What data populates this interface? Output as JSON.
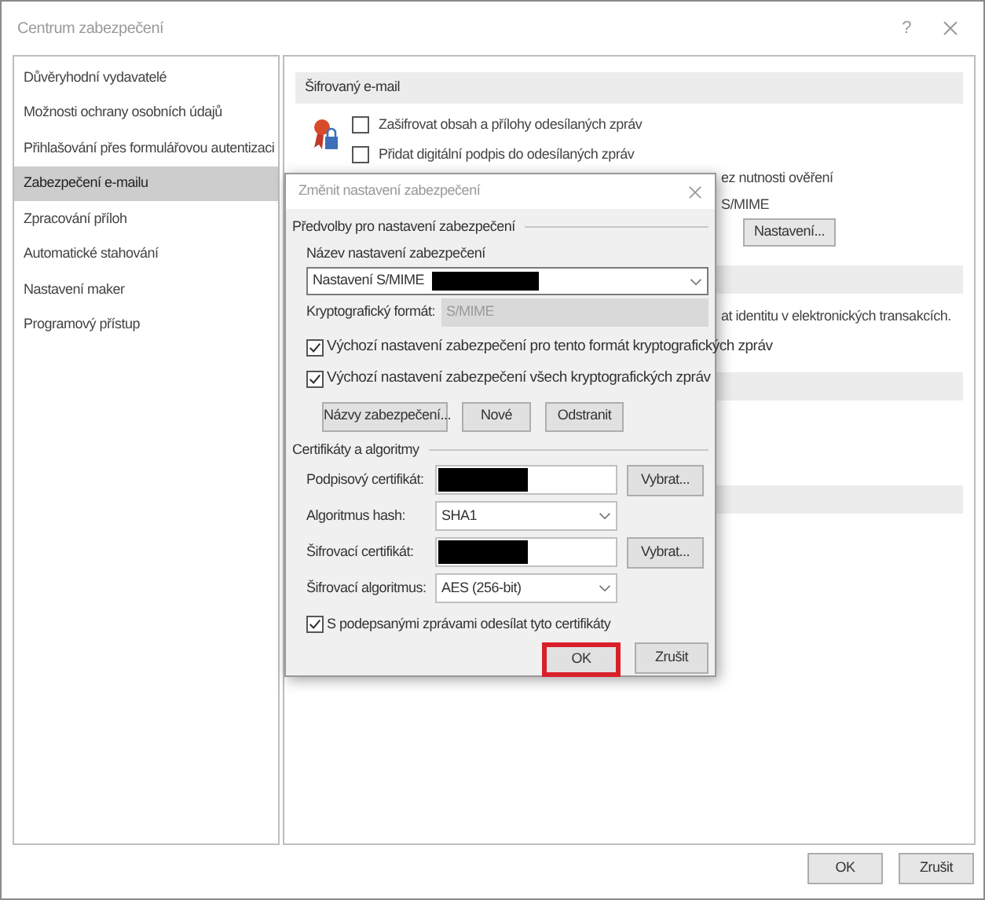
{
  "window": {
    "title": "Centrum zabezpečení",
    "help": "?"
  },
  "sidebar": {
    "items": [
      {
        "label": "Důvěryhodní vydavatelé",
        "selected": false
      },
      {
        "label": "Možnosti ochrany osobních údajů",
        "selected": false
      },
      {
        "label": "Přihlašování přes formulářovou autentizaci",
        "selected": false
      },
      {
        "label": "Zabezpečení e-mailu",
        "selected": true
      },
      {
        "label": "Zpracování příloh",
        "selected": false
      },
      {
        "label": "Automatické stahování",
        "selected": false
      },
      {
        "label": "Nastavení maker",
        "selected": false
      },
      {
        "label": "Programový přístup",
        "selected": false
      }
    ]
  },
  "content": {
    "section_title": "Šifrovaný e-mail",
    "options": [
      {
        "label": "Zašifrovat obsah a přílohy odesílaných zpráv",
        "checked": false
      },
      {
        "label": "Přidat digitální podpis do odesílaných zpráv",
        "checked": false
      }
    ],
    "partial_line_1": "ez nutnosti ověření",
    "partial_line_2": "S/MIME",
    "settings_button": "Nastavení...",
    "partial_line_3": "at identitu v elektronických transakcích."
  },
  "dialog": {
    "title": "Změnit nastavení zabezpečení",
    "group_1": "Předvolby pro nastavení zabezpečení",
    "name_label": "Název nastavení zabezpečení",
    "name_value": "Nastavení S/MIME",
    "format_label": "Kryptografický formát:",
    "format_value": "S/MIME",
    "format_disabled": true,
    "options": [
      {
        "label": "Výchozí nastavení zabezpečení pro tento formát kryptografických zpráv",
        "checked": true
      },
      {
        "label": "Výchozí nastavení zabezpečení všech kryptografických zpráv",
        "checked": true
      }
    ],
    "buttons": [
      "Názvy zabezpečení...",
      "Nové",
      "Odstranit"
    ],
    "group_2": "Certifikáty a algoritmy",
    "rows": [
      {
        "kind": "certificate",
        "label": "Podpisový certifikát:",
        "button": "Vybrat..."
      },
      {
        "kind": "select",
        "label": "Algoritmus hash:",
        "value": "SHA1"
      },
      {
        "kind": "certificate",
        "label": "Šifrovací certifikát:",
        "button": "Vybrat..."
      },
      {
        "kind": "select",
        "label": "Šifrovací algoritmus:",
        "value": "AES (256-bit)"
      }
    ],
    "send_certificates": {
      "label": "S podepsanými zprávami odesílat tyto certifikáty",
      "checked": true
    },
    "ok": {
      "label": "OK",
      "highlighted": true
    },
    "cancel": "Zrušit"
  },
  "footer": {
    "ok": "OK",
    "cancel": "Zrušit"
  }
}
